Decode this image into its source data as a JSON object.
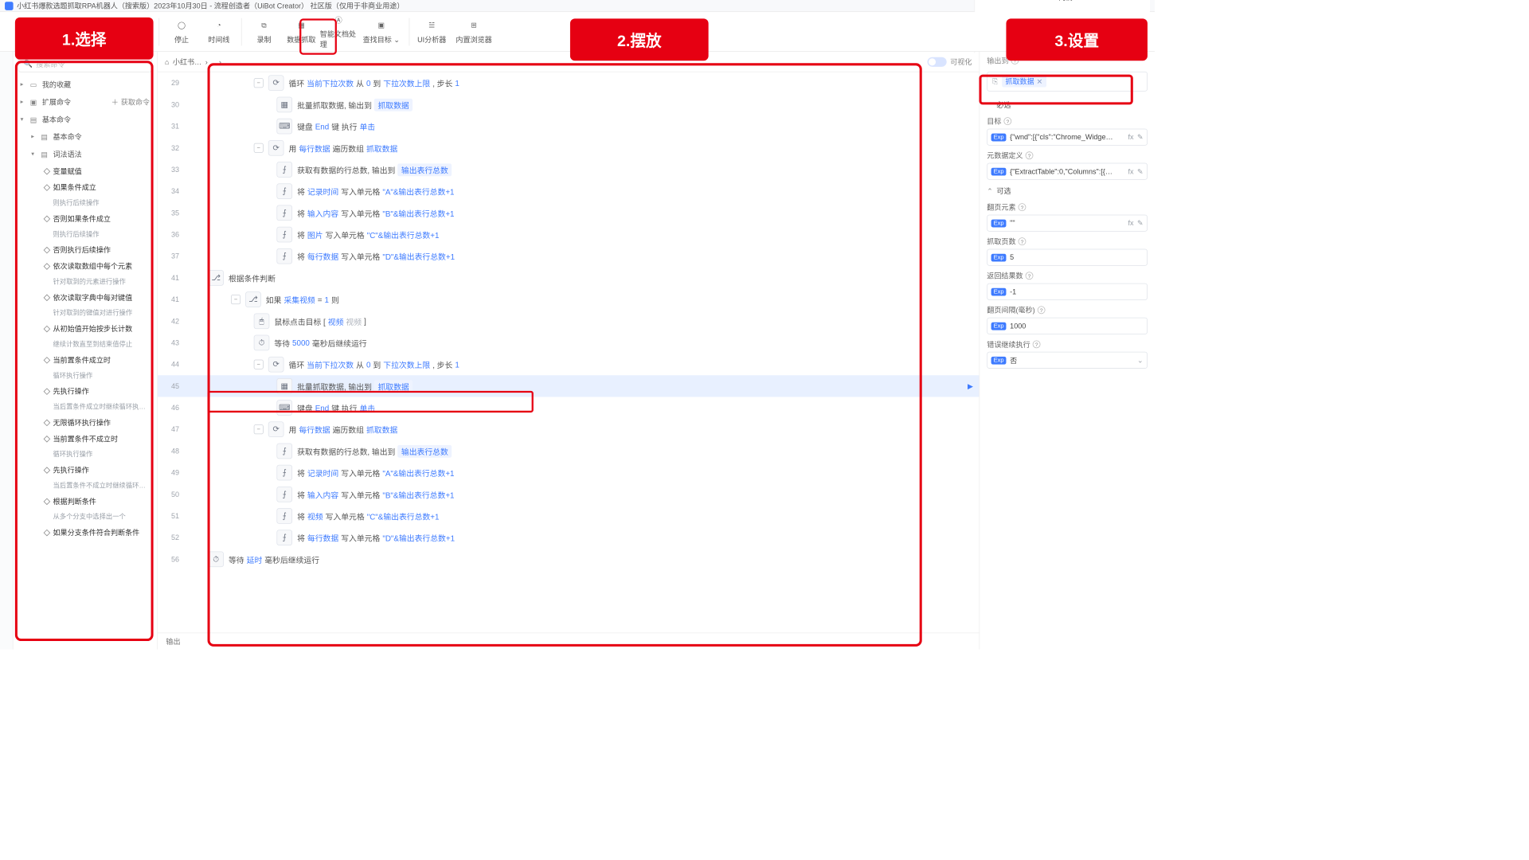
{
  "title": "小红书爆款选题抓取RPA机器人（搜索版）2023年10月30日 - 流程创造者（UiBot Creator）  社区版（仅用于非商业用途）",
  "user": "向倩",
  "toolbar": {
    "stop": "停止",
    "timeline": "时间线",
    "record": "录制",
    "data_extract": "数据抓取",
    "smart_doc": "智能文档处理",
    "find_target": "查找目标",
    "ui_analyzer": "UI分析器",
    "builtin_browser": "内置浏览器"
  },
  "banners": {
    "b1": "1.选择",
    "b2": "2.摆放",
    "b3": "3.设置"
  },
  "search_placeholder": "搜索命令",
  "left": {
    "fav": "我的收藏",
    "ext": "扩展命令",
    "get_cmd": "获取命令",
    "base": "基本命令",
    "base_cmd": "基本命令",
    "syntax": "词法语法",
    "items": [
      {
        "t": "变量赋值",
        "s": ""
      },
      {
        "t": "如果条件成立",
        "s": "则执行后续操作"
      },
      {
        "t": "否则如果条件成立",
        "s": "则执行后续操作"
      },
      {
        "t": "否则执行后续操作",
        "s": ""
      },
      {
        "t": "依次读取数组中每个元素",
        "s": "针对取到的元素进行操作"
      },
      {
        "t": "依次读取字典中每对键值",
        "s": "针对取到的键值对进行操作"
      },
      {
        "t": "从初始值开始按步长计数",
        "s": "继续计数直至到结束值停止"
      },
      {
        "t": "当前置条件成立时",
        "s": "循环执行操作"
      },
      {
        "t": "先执行操作",
        "s": "当后置条件成立时继续循环执…"
      },
      {
        "t": "无限循环执行操作",
        "s": ""
      },
      {
        "t": "当前置条件不成立时",
        "s": "循环执行操作"
      },
      {
        "t": "先执行操作",
        "s": "当后置条件不成立时继续循环…"
      },
      {
        "t": "根据判断条件",
        "s": "从多个分支中选择出一个"
      },
      {
        "t": "如果分支条件符合判断条件",
        "s": ""
      }
    ]
  },
  "crumb": "小红书…",
  "viz_label": "可视化",
  "code": [
    {
      "n": 29,
      "ind": 3,
      "fold": true,
      "ic": "loop",
      "parts": [
        "循环 ",
        [
          "kw",
          "当前下拉次数"
        ],
        " 从 ",
        [
          "kw",
          "0"
        ],
        " 到 ",
        [
          "kw",
          "下拉次数上限"
        ],
        ", 步长 ",
        [
          "kw",
          "1"
        ]
      ]
    },
    {
      "n": 30,
      "ind": 4,
      "ic": "grid",
      "parts": [
        "批量抓取数据, 输出到 ",
        [
          "tag",
          "抓取数据"
        ]
      ]
    },
    {
      "n": 31,
      "ind": 4,
      "ic": "kbd",
      "parts": [
        "键盘 ",
        [
          "kw",
          "End"
        ],
        " 键 执行 ",
        [
          "kw",
          "单击"
        ]
      ]
    },
    {
      "n": 32,
      "ind": 3,
      "fold": true,
      "ic": "loop",
      "parts": [
        "用 ",
        [
          "kw",
          "每行数据"
        ],
        " 遍历数组 ",
        [
          "kw",
          "抓取数据"
        ]
      ]
    },
    {
      "n": 33,
      "ind": 4,
      "ic": "fn",
      "parts": [
        "获取有数据的行总数, 输出到 ",
        [
          "tag",
          "输出表行总数"
        ]
      ]
    },
    {
      "n": 34,
      "ind": 4,
      "ic": "fn",
      "parts": [
        "将 ",
        [
          "kw",
          "记录时间"
        ],
        " 写入单元格 ",
        [
          "kw",
          "\"A\"&输出表行总数+1"
        ]
      ]
    },
    {
      "n": 35,
      "ind": 4,
      "ic": "fn",
      "parts": [
        "将 ",
        [
          "kw",
          "输入内容"
        ],
        " 写入单元格 ",
        [
          "kw",
          "\"B\"&输出表行总数+1"
        ]
      ]
    },
    {
      "n": 36,
      "ind": 4,
      "ic": "fn",
      "parts": [
        "将 ",
        [
          "kw",
          "图片"
        ],
        " 写入单元格 ",
        [
          "kw",
          "\"C\"&输出表行总数+1"
        ]
      ]
    },
    {
      "n": 37,
      "ind": 4,
      "ic": "fn",
      "parts": [
        "将 ",
        [
          "kw",
          "每行数据"
        ],
        " 写入单元格 ",
        [
          "kw",
          "\"D\"&输出表行总数+1"
        ]
      ]
    },
    {
      "n": 41,
      "ind": 1,
      "ic": "branch",
      "parts": [
        "根据条件判断"
      ]
    },
    {
      "n": 41,
      "ind": 2,
      "fold": true,
      "ic": "branch",
      "parts": [
        "如果 ",
        [
          "kw",
          "采集视频"
        ],
        " = ",
        [
          "kw",
          "1"
        ],
        " 则"
      ]
    },
    {
      "n": 42,
      "ind": 3,
      "ic": "mouse",
      "parts": [
        "鼠标点击目标 [ ",
        [
          "kw",
          "视频"
        ],
        " ",
        [
          "minor",
          "视频"
        ],
        "  ]"
      ]
    },
    {
      "n": 43,
      "ind": 3,
      "ic": "wait",
      "parts": [
        "等待 ",
        [
          "kw",
          "5000"
        ],
        " 毫秒后继续运行"
      ]
    },
    {
      "n": 44,
      "ind": 3,
      "fold": true,
      "ic": "loop",
      "parts": [
        "循环 ",
        [
          "kw",
          "当前下拉次数"
        ],
        " 从 ",
        [
          "kw",
          "0"
        ],
        " 到 ",
        [
          "kw",
          "下拉次数上限"
        ],
        ", 步长 ",
        [
          "kw",
          "1"
        ]
      ]
    },
    {
      "n": 45,
      "ind": 4,
      "ic": "grid",
      "sel": true,
      "parts": [
        "批量抓取数据, 输出到 ",
        [
          "tag",
          "抓取数据"
        ]
      ]
    },
    {
      "n": 46,
      "ind": 4,
      "ic": "kbd",
      "parts": [
        "键盘 ",
        [
          "kw",
          "End"
        ],
        " 键 执行 ",
        [
          "kw",
          "单击"
        ]
      ]
    },
    {
      "n": 47,
      "ind": 3,
      "fold": true,
      "ic": "loop",
      "parts": [
        "用 ",
        [
          "kw",
          "每行数据"
        ],
        " 遍历数组 ",
        [
          "kw",
          "抓取数据"
        ]
      ]
    },
    {
      "n": 48,
      "ind": 4,
      "ic": "fn",
      "parts": [
        "获取有数据的行总数, 输出到 ",
        [
          "tag",
          "输出表行总数"
        ]
      ]
    },
    {
      "n": 49,
      "ind": 4,
      "ic": "fn",
      "parts": [
        "将 ",
        [
          "kw",
          "记录时间"
        ],
        " 写入单元格 ",
        [
          "kw",
          "\"A\"&输出表行总数+1"
        ]
      ]
    },
    {
      "n": 50,
      "ind": 4,
      "ic": "fn",
      "parts": [
        "将 ",
        [
          "kw",
          "输入内容"
        ],
        " 写入单元格 ",
        [
          "kw",
          "\"B\"&输出表行总数+1"
        ]
      ]
    },
    {
      "n": 51,
      "ind": 4,
      "ic": "fn",
      "parts": [
        "将 ",
        [
          "kw",
          "视频"
        ],
        " 写入单元格 ",
        [
          "kw",
          "\"C\"&输出表行总数+1"
        ]
      ]
    },
    {
      "n": 52,
      "ind": 4,
      "ic": "fn",
      "parts": [
        "将 ",
        [
          "kw",
          "每行数据"
        ],
        " 写入单元格 ",
        [
          "kw",
          "\"D\"&输出表行总数+1"
        ]
      ]
    },
    {
      "n": 56,
      "ind": 1,
      "ic": "wait",
      "parts": [
        "等待 ",
        [
          "kw",
          "延时"
        ],
        " 毫秒后继续运行"
      ]
    }
  ],
  "output_label": "输出",
  "props": {
    "out_to": "输出到",
    "out_chip": "抓取数据",
    "required": "必选",
    "target": "目标",
    "target_val": "{\"wnd\":[{\"cls\":\"Chrome_Widge…",
    "meta": "元数据定义",
    "meta_val": "{\"ExtractTable\":0,\"Columns\":[{…",
    "optional": "可选",
    "page_elem": "翻页元素",
    "page_elem_val": "\"\"",
    "pages": "抓取页数",
    "pages_val": "5",
    "rows": "返回结果数",
    "rows_val": "-1",
    "interval": "翻页间隔(毫秒)",
    "interval_val": "1000",
    "on_err": "错误继续执行",
    "on_err_val": "否"
  }
}
